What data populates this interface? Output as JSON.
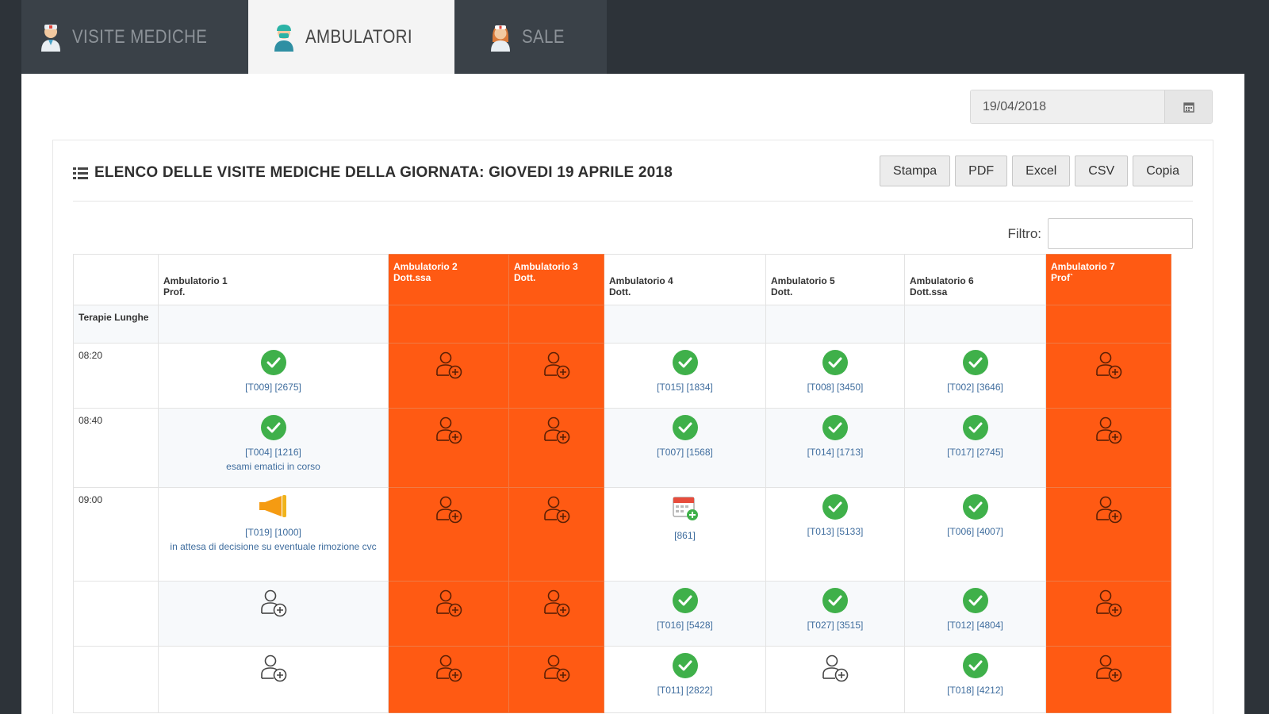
{
  "tabs": [
    {
      "label": "VISITE MEDICHE",
      "active": false
    },
    {
      "label": "AMBULATORI",
      "active": true
    },
    {
      "label": "SALE",
      "active": false
    }
  ],
  "date": {
    "value": "19/04/2018",
    "button_icon": "calendar-icon"
  },
  "card": {
    "title": "ELENCO DELLE VISITE MEDICHE DELLA GIORNATA: GIOVEDI 19 APRILE 2018",
    "title_icon": "list-icon"
  },
  "toolbar": {
    "stampa": "Stampa",
    "pdf": "PDF",
    "excel": "Excel",
    "csv": "CSV",
    "copia": "Copia"
  },
  "filter": {
    "label": "Filtro:",
    "value": ""
  },
  "colors": {
    "accent": "#ff5a13",
    "check": "#3fb04a",
    "link": "#3f6d9e",
    "dark": "#2d3339"
  },
  "table": {
    "columns": [
      {
        "name": "Ambulatorio 1",
        "doctor": "Prof.",
        "highlighted": false
      },
      {
        "name": "Ambulatorio 2",
        "doctor": "Dott.ssa",
        "highlighted": true
      },
      {
        "name": "Ambulatorio 3",
        "doctor": "Dott.",
        "highlighted": true
      },
      {
        "name": "Ambulatorio 4",
        "doctor": "Dott.",
        "highlighted": false
      },
      {
        "name": "Ambulatorio 5",
        "doctor": "Dott.",
        "highlighted": false
      },
      {
        "name": "Ambulatorio 6",
        "doctor": "Dott.ssa",
        "highlighted": false
      },
      {
        "name": "Ambulatorio 7",
        "doctor": "Prof`",
        "highlighted": true
      }
    ],
    "terapie_label": "Terapie Lunghe",
    "rows": [
      {
        "time": "08:20",
        "cells": [
          {
            "icon": "check-icon",
            "code": "[T009] [2675]",
            "note": ""
          },
          {
            "icon": "add-user-icon"
          },
          {
            "icon": "add-user-icon"
          },
          {
            "icon": "check-icon",
            "code": "[T015] [1834]",
            "note": ""
          },
          {
            "icon": "check-icon",
            "code": "[T008] [3450]",
            "note": ""
          },
          {
            "icon": "check-icon",
            "code": "[T002] [3646]",
            "note": ""
          },
          {
            "icon": "add-user-icon"
          }
        ]
      },
      {
        "time": "08:40",
        "cells": [
          {
            "icon": "check-icon",
            "code": "[T004] [1216]",
            "note": "esami ematici in corso"
          },
          {
            "icon": "add-user-icon"
          },
          {
            "icon": "add-user-icon"
          },
          {
            "icon": "check-icon",
            "code": "[T007] [1568]",
            "note": ""
          },
          {
            "icon": "check-icon",
            "code": "[T014] [1713]",
            "note": ""
          },
          {
            "icon": "check-icon",
            "code": "[T017] [2745]",
            "note": ""
          },
          {
            "icon": "add-user-icon"
          }
        ]
      },
      {
        "time": "09:00",
        "cells": [
          {
            "icon": "megaphone-icon",
            "code": "[T019] [1000]",
            "note": "in attesa di decisione su eventuale rimozione cvc"
          },
          {
            "icon": "add-user-icon"
          },
          {
            "icon": "add-user-icon"
          },
          {
            "icon": "calendar-add-icon",
            "code": "[861]",
            "note": ""
          },
          {
            "icon": "check-icon",
            "code": "[T013] [5133]",
            "note": ""
          },
          {
            "icon": "check-icon",
            "code": "",
            "note": "[T006] [4007]"
          },
          {
            "icon": "add-user-icon"
          }
        ]
      },
      {
        "time": "",
        "cells": [
          {
            "icon": "add-user-icon"
          },
          {
            "icon": "add-user-icon"
          },
          {
            "icon": "add-user-icon"
          },
          {
            "icon": "check-icon",
            "code": "[T016] [5428]",
            "note": ""
          },
          {
            "icon": "check-icon",
            "code": "[T027] [3515]",
            "note": ""
          },
          {
            "icon": "check-icon",
            "code": "[T012] [4804]",
            "note": ""
          },
          {
            "icon": "add-user-icon"
          }
        ]
      },
      {
        "time": "",
        "cells": [
          {
            "icon": "add-user-icon"
          },
          {
            "icon": "add-user-icon"
          },
          {
            "icon": "add-user-icon"
          },
          {
            "icon": "check-icon",
            "code": "[T011] [2822]",
            "note": ""
          },
          {
            "icon": "add-user-icon"
          },
          {
            "icon": "check-icon",
            "code": "[T018] [4212]",
            "note": ""
          },
          {
            "icon": "add-user-icon"
          }
        ]
      }
    ]
  }
}
